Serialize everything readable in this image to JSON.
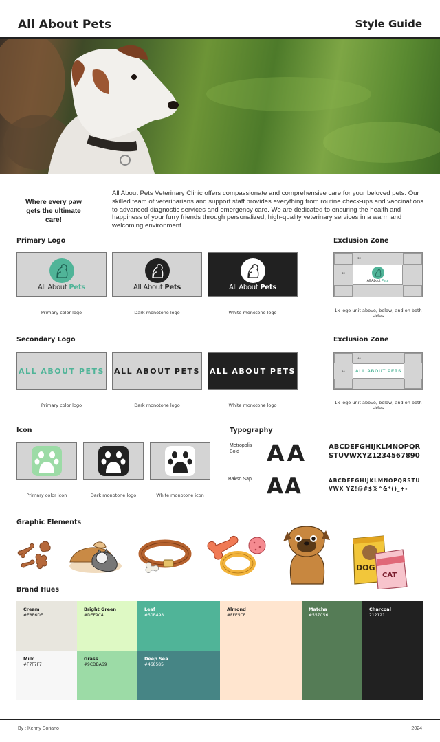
{
  "header": {
    "brand": "All About Pets",
    "guide": "Style Guide"
  },
  "intro": {
    "tagline": "Where every paw gets the ultimate care!",
    "body": "All About Pets Veterinary Clinic offers compassionate and comprehensive care for your beloved pets. Our skilled team of veterinarians and support staff provides everything from routine check-ups and vaccinations to advanced diagnostic services and emergency care. We are dedicated to ensuring the health and happiness of your furry friends through personalized, high-quality veterinary services in a warm and welcoming environment."
  },
  "primary_logo": {
    "title": "Primary Logo",
    "logo_word_regular": "All About",
    "logo_word_bold": "Pets",
    "variants": [
      {
        "caption": "Primary color logo"
      },
      {
        "caption": "Dark monotone logo"
      },
      {
        "caption": "White monotone logo"
      }
    ]
  },
  "secondary_logo": {
    "title": "Secondary Logo",
    "wordmark": "ALL ABOUT PETS",
    "variants": [
      {
        "caption": "Primary color logo"
      },
      {
        "caption": "Dark monotone logo"
      },
      {
        "caption": "White monotone logo"
      }
    ]
  },
  "exclusion_zone": {
    "title": "Exclusion Zone",
    "unit_label": "1x",
    "caption": "1x logo unit above, below, and on both sides"
  },
  "icon": {
    "title": "Icon",
    "variants": [
      {
        "caption": "Primary color icon"
      },
      {
        "caption": "Dark monotone logo"
      },
      {
        "caption": "White monotone icon"
      }
    ]
  },
  "typography": {
    "title": "Typography",
    "fonts": [
      {
        "name": "Metropolis Bold",
        "sample": "AA",
        "charset": "ABCDEFGHIJKLMNOPQR STUVWXYZ1234567890"
      },
      {
        "name": "Bakso Sapi",
        "sample": "AA",
        "charset": "ABCDEFGHIJKLMNOPQRSTU VWX YZ!@#$%^&*()_+-"
      }
    ]
  },
  "graphic_elements": {
    "title": "Graphic Elements",
    "items": [
      "dog-treats-icon",
      "sleeping-pets-icon",
      "dog-collar-icon",
      "chew-toys-icon",
      "pug-dog-icon",
      "pet-food-bags-icon"
    ],
    "food_bag_labels": {
      "dog": "DOG",
      "cat": "CAT"
    }
  },
  "brand_hues": {
    "title": "Brand Hues",
    "swatches": [
      {
        "name": "Cream",
        "hex": "#E8E6DE"
      },
      {
        "name": "Bright Green",
        "hex": "#DEF9C4"
      },
      {
        "name": "Leaf",
        "hex": "#50B498"
      },
      {
        "name": "Almond",
        "hex": "#FFE5CF"
      },
      {
        "name": "Matcha",
        "hex": "#557C56"
      },
      {
        "name": "Charcoal",
        "hex": "212121"
      },
      {
        "name": "Milk",
        "hex": "#F7F7F7"
      },
      {
        "name": "Grass",
        "hex": "#9CDBA69"
      },
      {
        "name": "Deep Sea",
        "hex": "#468585"
      }
    ]
  },
  "footer": {
    "author": "By : Kenny Soriano",
    "year": "2024"
  }
}
